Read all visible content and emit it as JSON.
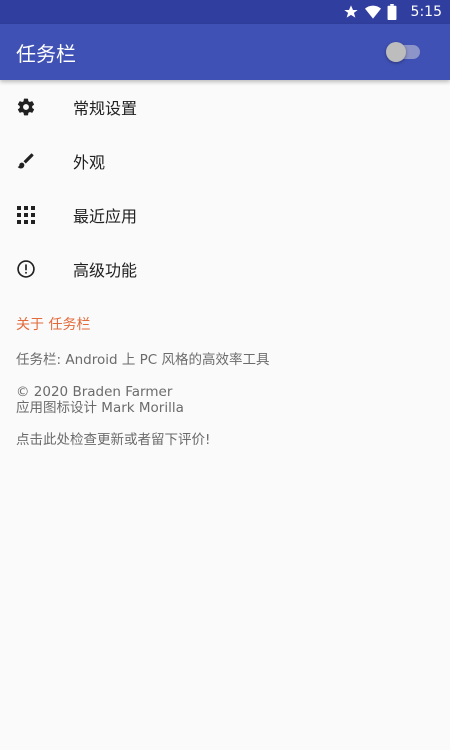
{
  "status_bar": {
    "time": "5:15",
    "icons": [
      "star-icon",
      "wifi-icon",
      "battery-icon"
    ],
    "bg_color": "#303f9f"
  },
  "app_bar": {
    "title": "任务栏",
    "bg_color": "#3f51b5",
    "toggle_state": "off"
  },
  "menu": {
    "items": [
      {
        "label": "常规设置",
        "icon": "gear-icon"
      },
      {
        "label": "外观",
        "icon": "brush-icon"
      },
      {
        "label": "最近应用",
        "icon": "grid-icon"
      },
      {
        "label": "高级功能",
        "icon": "alert-circle-icon"
      }
    ]
  },
  "about": {
    "header": "关于 任务栏",
    "header_color": "#e36a3b",
    "description": "任务栏: Android 上 PC 风格的高效率工具",
    "copyright_line1": "© 2020 Braden Farmer",
    "copyright_line2": "应用图标设计 Mark Morilla",
    "review_link": "点击此处检查更新或者留下评价!"
  }
}
